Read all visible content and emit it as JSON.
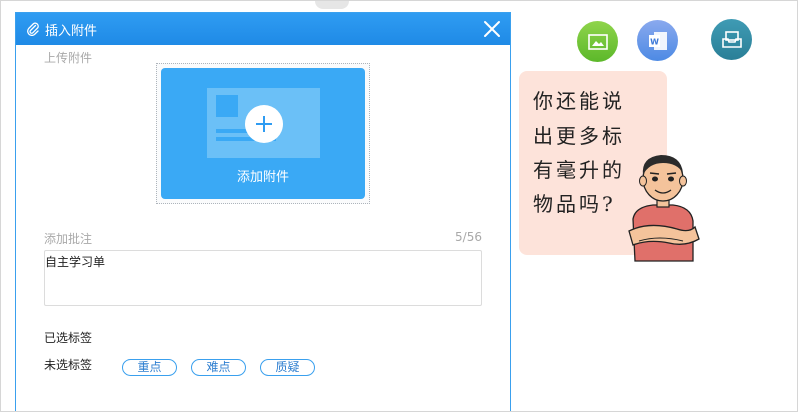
{
  "dialog": {
    "title": "插入附件",
    "upload_section_label": "上传附件",
    "upload_button_label": "添加附件",
    "note_label": "添加批注",
    "note_counter": "5/56",
    "note_value": "自主学习单",
    "selected_tags_label": "已选标签",
    "unselected_tags_label": "未选标签",
    "tags": [
      "重点",
      "难点",
      "质疑"
    ]
  },
  "bubble": {
    "lines": [
      "你还能说",
      "出更多标",
      "有毫升的",
      "物品吗?"
    ]
  },
  "colors": {
    "accent": "#2f9cf2",
    "upload_card": "#3aa9f5",
    "bubble_bg": "#fde3da"
  },
  "icons": [
    "paperclip-icon",
    "close-icon",
    "image-icon",
    "word-doc-icon",
    "inbox-tray-icon"
  ]
}
